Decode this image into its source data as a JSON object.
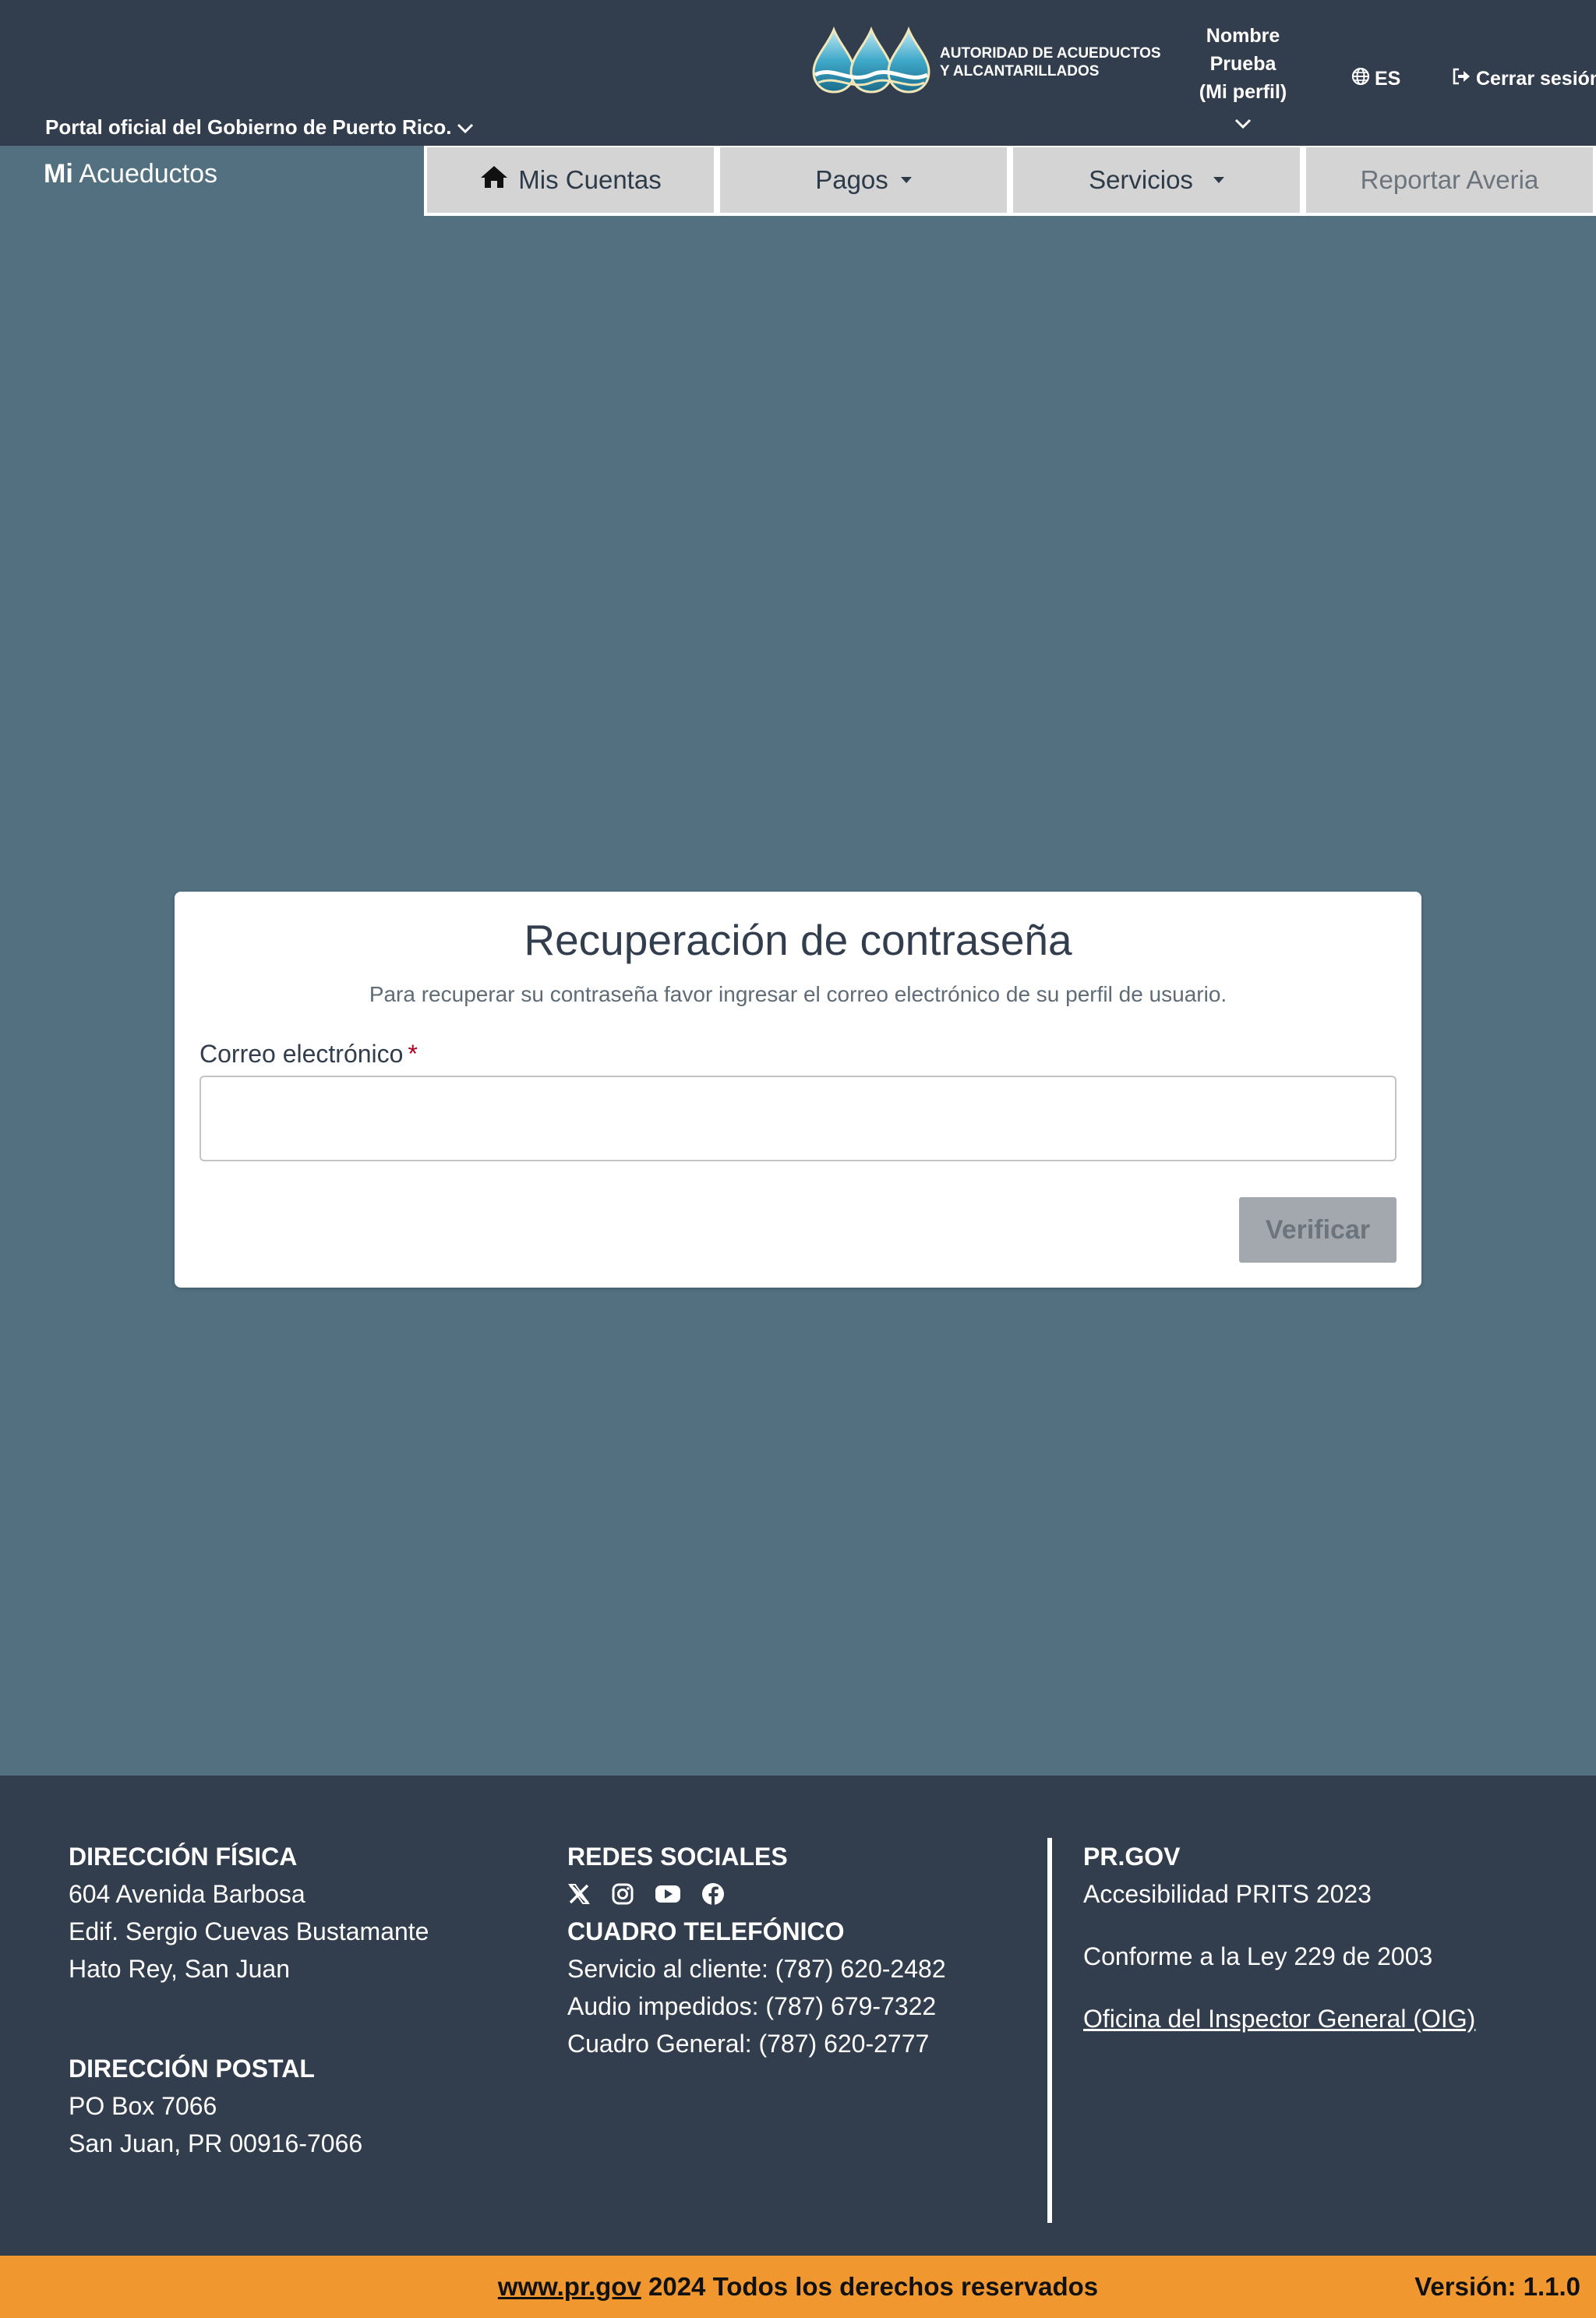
{
  "header": {
    "gov_link": "Portal oficial del Gobierno de Puerto Rico.",
    "logo_line1": "AUTORIDAD DE ACUEDUCTOS",
    "logo_line2": "Y ALCANTARILLADOS",
    "profile_line1": "Nombre",
    "profile_line2": "Prueba",
    "profile_line3": "(Mi perfil)",
    "language": "ES",
    "logout": "Cerrar sesión",
    "brand_bold": "Mi",
    "brand_rest": "Acueductos"
  },
  "nav": {
    "items": [
      {
        "label": "Mis Cuentas",
        "icon": "home-icon"
      },
      {
        "label": "Pagos",
        "dropdown": true
      },
      {
        "label": "Servicios",
        "dropdown": true
      },
      {
        "label": "Reportar Averia",
        "disabled": true
      }
    ]
  },
  "form": {
    "title": "Recuperación de contraseña",
    "subtitle": "Para recuperar su contraseña favor ingresar el correo electrónico de su perfil de usuario.",
    "email_label": "Correo electrónico",
    "required_mark": "*",
    "email_value": "",
    "verify_label": "Verificar"
  },
  "footer": {
    "physical_title": "DIRECCIÓN FÍSICA",
    "physical_lines": [
      "604 Avenida Barbosa",
      "Edif. Sergio Cuevas Bustamante",
      "Hato Rey, San Juan"
    ],
    "postal_title": "DIRECCIÓN POSTAL",
    "postal_lines": [
      "PO Box 7066",
      "San Juan, PR 00916-7066"
    ],
    "social_title": "REDES SOCIALES",
    "social_icons": [
      "x-icon",
      "instagram-icon",
      "youtube-icon",
      "facebook-icon"
    ],
    "phone_title": "CUADRO TELEFÓNICO",
    "phone_lines": [
      "Servicio al cliente: (787) 620-2482",
      "Audio impedidos: (787) 679-7322",
      "Cuadro General: (787) 620-2777"
    ],
    "prgov_title": "PR.GOV",
    "prgov_lines": [
      "Accesibilidad PRITS 2023",
      "Conforme a la Ley 229 de 2003",
      "Oficina del Inspector General (OIG)"
    ],
    "copyright_link": "www.pr.gov",
    "copyright_text": "2024 Todos los derechos reservados",
    "version": "Versión: 1.1.0"
  },
  "colors": {
    "header_bg": "#323e4e",
    "page_bg": "#52707f",
    "nav_item_bg": "#d4d4d4",
    "bottom_bar": "#f0982f",
    "button_disabled": "#a2a8ae",
    "required": "#b00020"
  }
}
